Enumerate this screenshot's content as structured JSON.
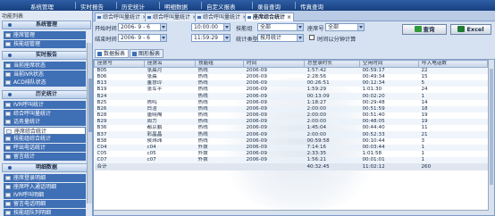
{
  "menu": [
    "系统管理",
    "实时报告",
    "历史统计",
    "明细数据",
    "自定义报表",
    "录音查询",
    "传真查询"
  ],
  "sidebar": {
    "title": "功能列表",
    "groups": [
      {
        "label": "系统管理",
        "items": [
          "座席管理",
          "技能组管理"
        ]
      },
      {
        "label": "实时报告",
        "items": [
          "当前座席状态",
          "当前IVR状态",
          "ACD排队状态"
        ]
      },
      {
        "label": "历史统计",
        "items": [
          "IVR呼叫统计",
          "综合呼叫量统计",
          "话务量统计",
          "座席综合统计",
          "技能组综合统计",
          "呼出电话统计",
          "留言统计"
        ]
      },
      {
        "label": "明细数据",
        "items": [
          "座席登录明细",
          "座席呼入通话明细",
          "IVR呼叫明细",
          "留言电话明细",
          "技能组队列明细",
          "呼叫明细数据"
        ]
      }
    ],
    "selected": "座席综合统计"
  },
  "tabs": [
    {
      "label": "综合呼叫量统计",
      "active": false
    },
    {
      "label": "综合呼叫量统计",
      "active": false
    },
    {
      "label": "综合呼叫量统计",
      "active": false
    },
    {
      "label": "座席综合统计",
      "active": true
    }
  ],
  "filters": {
    "start_time_label": "开始时间",
    "start_date": "2006- 9 - 6",
    "start_clock": "10:00:00",
    "end_time_label": "结束时间",
    "end_date": "2006- 9 - 6",
    "end_clock": "11:59:29",
    "skill_label": "技能组",
    "skill_value": "全部",
    "stat_type_label": "统计类型",
    "stat_type_value": "按月统计",
    "agent_label": "座席号",
    "agent_value": "全部",
    "hourly_label": "时间以分钟计算",
    "query_label": "查询",
    "excel_label": "Excel"
  },
  "view_tabs": [
    "数据报表",
    "图形报表"
  ],
  "table": {
    "columns": [
      "座席号",
      "座席名",
      "技能组",
      "时间",
      "总登录时长",
      "空闲时间",
      "呼入电话数"
    ],
    "rows": [
      [
        "B05",
        "张晨月",
        "热线",
        "2006-09",
        "1:57:42",
        "00:59:17",
        "22"
      ],
      [
        "B06",
        "张晨",
        "热线",
        "2006-09",
        "2:28:56",
        "00:49:34",
        "15"
      ],
      [
        "B13",
        "董慧玲",
        "热线",
        "2006-09",
        "00:26:51",
        "00:12:34",
        "5"
      ],
      [
        "B19",
        "张军平",
        "热线",
        "2006-09",
        "1:59:29",
        "1:01:30",
        "24"
      ],
      [
        "B24",
        "",
        "热线",
        "2006-09",
        "00:13:09",
        "00:02:20",
        "1"
      ],
      [
        "B25",
        "陈鸣",
        "热线",
        "2006-09",
        "1:18:27",
        "00:29:48",
        "14"
      ],
      [
        "B26",
        "白洁",
        "热线",
        "2006-09",
        "2:00:00",
        "00:51:59",
        "18"
      ],
      [
        "B28",
        "唐晓陶",
        "热线",
        "2006-09",
        "2:00:00",
        "00:51:40",
        "19"
      ],
      [
        "B29",
        "周力",
        "热线",
        "2006-09",
        "2:00:00",
        "00:48:05",
        "19"
      ],
      [
        "B36",
        "都京鹏",
        "热线",
        "2006-09",
        "1:45:04",
        "00:44:40",
        "11"
      ],
      [
        "B37",
        "彩晶晶",
        "热线",
        "2006-09",
        "2:00:00",
        "00:52:33",
        "21"
      ],
      [
        "B38",
        "侯玮玮",
        "热线",
        "2006-09",
        "00:59:58",
        "00:10:44",
        "3"
      ],
      [
        "C04",
        "c04",
        "外拨",
        "2006-09",
        "7:14:16",
        "00:03:44",
        "1"
      ],
      [
        "C05",
        "c05",
        "外拨",
        "2006-09",
        "2:33:35",
        "1:01:58",
        "1"
      ],
      [
        "C07",
        "c07",
        "外拨",
        "2006-09",
        "1:56:21",
        "00:01:01",
        "1"
      ]
    ],
    "total": [
      "合计",
      "",
      "",
      "",
      "40:32:45",
      "11:02:12",
      "260"
    ]
  }
}
